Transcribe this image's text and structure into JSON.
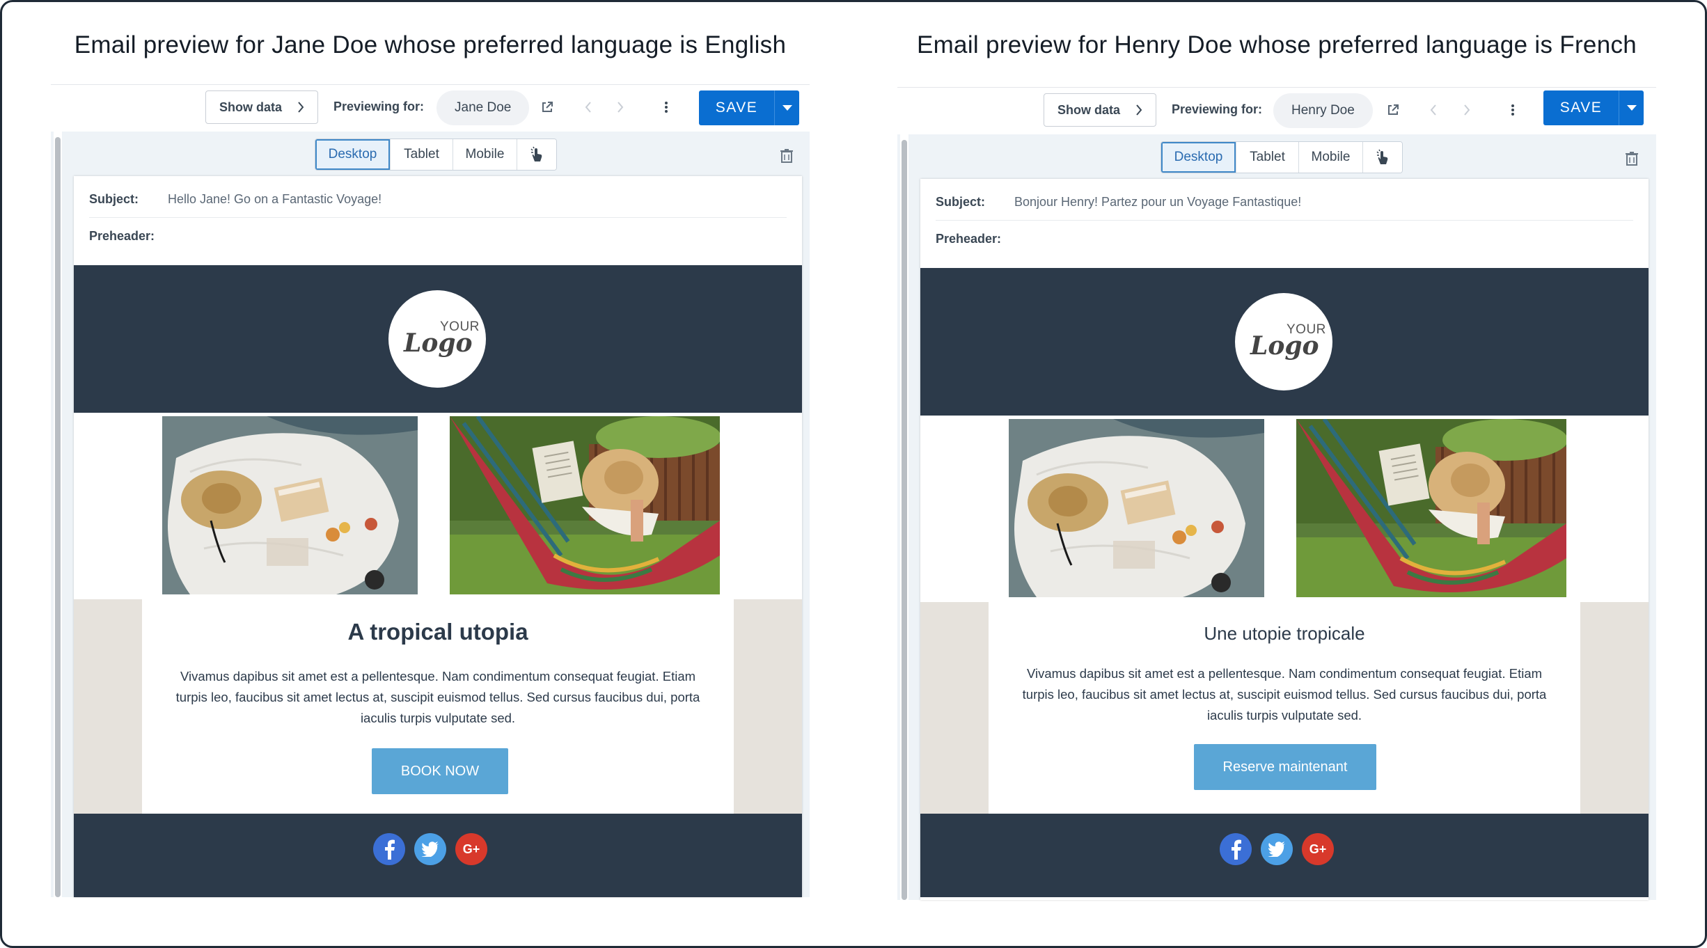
{
  "colors": {
    "save_blue": "#0a6ed1",
    "email_dark": "#2c3a4a",
    "cta_blue": "#5aa6d6",
    "side_beige": "#e6e2dc",
    "facebook": "#3b6fd6",
    "twitter": "#4ca0e6",
    "google_plus": "#d8392b"
  },
  "logo": {
    "line1": "YOUR",
    "line2": "Logo"
  },
  "panels": [
    {
      "caption": "Email preview for Jane Doe whose preferred language is English",
      "toolbar": {
        "show_data_label": "Show data",
        "previewing_label": "Previewing for:",
        "contact_name": "Jane Doe",
        "save_label": "SAVE",
        "icons": [
          "external-link-icon",
          "chevron-left-icon",
          "chevron-right-icon",
          "more-vertical-icon",
          "caret-down-icon"
        ]
      },
      "device_tabs": [
        "Desktop",
        "Tablet",
        "Mobile"
      ],
      "active_device": "Desktop",
      "email": {
        "subject_label": "Subject:",
        "subject_value": "Hello Jane! Go on a Fantastic Voyage!",
        "preheader_label": "Preheader:",
        "headline": "A tropical utopia",
        "body": "Vivamus dapibus sit amet est a pellentesque. Nam condimentum consequat feugiat. Etiam turpis leo, faucibus sit amet lectus at, suscipit euismod tellus. Sed cursus faucibus dui, porta iaculis turpis vulputate sed.",
        "cta_label": "BOOK NOW",
        "social_icons": [
          "facebook-icon",
          "twitter-icon",
          "google-plus-icon"
        ]
      }
    },
    {
      "caption": "Email preview for Henry Doe whose preferred language is French",
      "toolbar": {
        "show_data_label": "Show data",
        "previewing_label": "Previewing for:",
        "contact_name": "Henry Doe",
        "save_label": "SAVE",
        "icons": [
          "external-link-icon",
          "chevron-left-icon",
          "chevron-right-icon",
          "more-vertical-icon",
          "caret-down-icon"
        ]
      },
      "device_tabs": [
        "Desktop",
        "Tablet",
        "Mobile"
      ],
      "active_device": "Desktop",
      "email": {
        "subject_label": "Subject:",
        "subject_value": "Bonjour Henry! Partez pour un Voyage Fantastique!",
        "preheader_label": "Preheader:",
        "headline": "Une utopie tropicale",
        "body": "Vivamus dapibus sit amet est a pellentesque. Nam condimentum consequat feugiat. Etiam turpis leo, faucibus sit amet lectus at, suscipit euismod tellus. Sed cursus faucibus dui, porta iaculis turpis vulputate sed.",
        "cta_label": "Reserve maintenant",
        "social_icons": [
          "facebook-icon",
          "twitter-icon",
          "google-plus-icon"
        ]
      }
    }
  ]
}
